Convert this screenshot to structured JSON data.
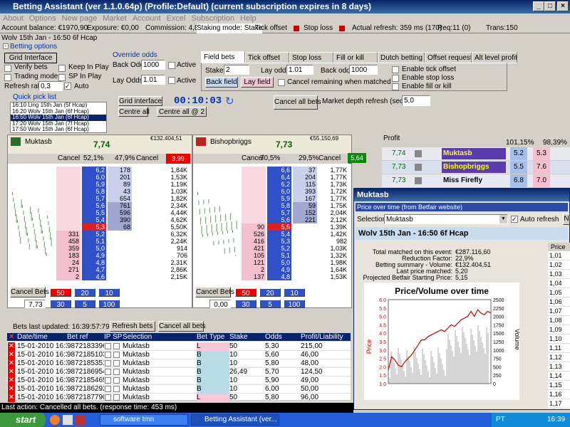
{
  "window": {
    "title": "Betting Assistant (ver 1.1.0.64p)     (Profile:Default)     (current subscription expires in 8 days)"
  },
  "menu": [
    "About",
    "Options",
    "New page",
    "Market",
    "Account",
    "Excel",
    "Subscription",
    "Help"
  ],
  "status": {
    "balance": "Account balance: €1970,90",
    "exposure": "Exposure: €0,00",
    "commission": "Commission: 4,80%",
    "staking": "Staking mode: Stake",
    "tick_offset": "Tick offset",
    "stop_loss": "Stop loss",
    "actual_refresh": "Actual refresh: 359 ms (170)",
    "req": "Req:11 (0)",
    "trans": "Trans:150"
  },
  "market_title": "Wolv 15th Jan - 16:50 6f Hcap",
  "betting_options": {
    "label": "Betting options",
    "grid_interface": "Grid Interface",
    "verify_bets": "Verify bets",
    "keep_in_play": "Keep In Play",
    "trading_mode": "Trading mode",
    "sp_in_play": "SP In Play",
    "refresh_rate": "Refresh rate",
    "refresh_value": "0,3",
    "auto": "Auto"
  },
  "override_odds": {
    "label": "Override odds",
    "back_odds": "Back Odds",
    "back_value": "1000",
    "lay_odds": "Lay Odds",
    "lay_value": "1.01",
    "active": "Active"
  },
  "tabs": [
    "Field bets",
    "Tick offset",
    "Stop loss",
    "Fill or kill",
    "Dutch betting",
    "Offset requests",
    "Alt level profit"
  ],
  "field_bets": {
    "stake": "Stake",
    "stake_value": "2",
    "lay_odds": "Lay odds",
    "lay_value": "1.01",
    "back_odds": "Back odds",
    "back_value": "1000",
    "back_field": "Back field",
    "lay_field": "Lay field",
    "cancel_remaining": "Cancel remaining when matched",
    "enable_tick": "Enable tick offset",
    "enable_stop": "Enable stop loss",
    "enable_fill": "Enable fill or kill"
  },
  "quick_pick": {
    "label": "Quick pick list",
    "items": [
      "16:10 Ling 15th Jan (5f Hcap)",
      "16:20 Wolv 15th Jan (6f Hcap)",
      "16:50 Wolv 15th Jan (6f Hcap)",
      "17:20 Wolv 15th Jan (7f Hcap)",
      "17:50 Wolv 15th Jan (6f Hcap)"
    ]
  },
  "controls": {
    "grid_interface": "Grid interface",
    "timer": "00:10:03",
    "centre_all": "Centre all",
    "centre_all_2": "Centre all @ 2",
    "cancel_all": "Cancel all bets",
    "depth_label": "Market depth refresh (seconds)",
    "depth_value": "5,0"
  },
  "ladder1": {
    "name": "Muktasb",
    "price": "7,74",
    "matched": "€132.404,51",
    "cancel": "Cancel",
    "back_pct": "52,1%",
    "lay_pct": "47,9%",
    "cancel2": "Cancel",
    "ltp": "3,99",
    "rows": [
      [
        "",
        "6,2",
        "178",
        "1,84K"
      ],
      [
        "",
        "6,0",
        "201",
        "1,53K"
      ],
      [
        "",
        "5,9",
        "89",
        "1,19K"
      ],
      [
        "",
        "5,8",
        "43",
        "1,03K"
      ],
      [
        "",
        "5,7",
        "654",
        "1,82K"
      ],
      [
        "",
        "5,6",
        "761",
        "2,34K"
      ],
      [
        "",
        "5,5",
        "596",
        "4,44K"
      ],
      [
        "",
        "5,4",
        "390",
        "4,62K"
      ],
      [
        "",
        "5,3",
        "68",
        "5,50K"
      ],
      [
        "331",
        "5,2",
        "",
        "6,32K"
      ],
      [
        "458",
        "5,1",
        "",
        "2,24K"
      ],
      [
        "359",
        "5,0",
        "",
        "914"
      ],
      [
        "183",
        "4,9",
        "",
        "706"
      ],
      [
        "24",
        "4,8",
        "",
        "2,31K"
      ],
      [
        "271",
        "4,7",
        "",
        "2,86K"
      ],
      [
        "2",
        "4,6",
        "",
        "2,15K"
      ]
    ],
    "cancel_bets": "Cancel Bets",
    "stake_display": "7,73",
    "b1": "50",
    "b2": "20",
    "b3": "10",
    "b4": "30",
    "b5": "5",
    "b6": "100"
  },
  "ladder2": {
    "name": "Bishopbriggs",
    "price": "7,73",
    "matched": "€55.150,69",
    "cancel": "Cancel",
    "back_pct": "70,5%",
    "lay_pct": "29,5%",
    "cancel2": "Cancel",
    "ltp": "5,64",
    "rows": [
      [
        "",
        "6,6",
        "37",
        "1,77K"
      ],
      [
        "",
        "6,4",
        "204",
        "1,77K"
      ],
      [
        "",
        "6,2",
        "115",
        "1,73K"
      ],
      [
        "",
        "6,0",
        "393",
        "1,72K"
      ],
      [
        "",
        "5,9",
        "167",
        "1,77K"
      ],
      [
        "",
        "5,8",
        "59",
        "1,75K"
      ],
      [
        "",
        "5,7",
        "152",
        "2,04K"
      ],
      [
        "",
        "5,6",
        "221",
        "2,12K"
      ],
      [
        "90",
        "5,5",
        "",
        "1,39K"
      ],
      [
        "526",
        "5,4",
        "",
        "1,42K"
      ],
      [
        "416",
        "5,3",
        "",
        "982"
      ],
      [
        "421",
        "5,2",
        "",
        "1,03K"
      ],
      [
        "105",
        "5,1",
        "",
        "1,32K"
      ],
      [
        "121",
        "5,0",
        "",
        "1,98K"
      ],
      [
        "2",
        "4,9",
        "",
        "1,64K"
      ],
      [
        "137",
        "4,8",
        "",
        "1,53K"
      ]
    ],
    "cancel_bets": "Cancel Bets",
    "stake_display": "0,00",
    "b1": "50",
    "b2": "20",
    "b3": "10",
    "b4": "30",
    "b5": "5",
    "b6": "100"
  },
  "profit": {
    "label": "Profit",
    "pct1": "101,15%",
    "pct2": "98,39%",
    "rows": [
      [
        "7,74",
        "Muktasb",
        "5.2",
        "5.3"
      ],
      [
        "7,73",
        "Bishopbriggs",
        "5.5",
        "7.6"
      ],
      [
        "7,73",
        "Miss Firefly",
        "6.8",
        "7.0"
      ]
    ]
  },
  "bets": {
    "last_updated": "Bets last updated: 16:39:57:796",
    "refresh": "Refresh bets",
    "cancel_all": "Cancel all bets",
    "headers": [
      "Date/time",
      "Bet ref",
      "IP",
      "SP",
      "Selection",
      "Bet Type",
      "Stake",
      "Odds",
      "Profit/Liability"
    ],
    "rows": [
      [
        "15-01-2010 16:34",
        "9872183396",
        "Muktasb",
        "L",
        "50",
        "5,30",
        "215,00"
      ],
      [
        "15-01-2010 16:34",
        "9872185103",
        "Muktasb",
        "B",
        "10",
        "5,60",
        "46,00"
      ],
      [
        "15-01-2010 16:34",
        "9872185351",
        "Muktasb",
        "B",
        "10",
        "5,80",
        "48,00"
      ],
      [
        "15-01-2010 16:34",
        "9872186954",
        "Muktasb",
        "B",
        "26,49",
        "5,70",
        "124,50"
      ],
      [
        "15-01-2010 16:34",
        "9872185465",
        "Muktasb",
        "B",
        "10",
        "5,90",
        "49,00"
      ],
      [
        "15-01-2010 16:34",
        "9872186292",
        "Muktasb",
        "B",
        "10",
        "6,00",
        "50,00"
      ],
      [
        "15-01-2010 16:34",
        "9872187790",
        "Muktasb",
        "L",
        "50",
        "5,80",
        "96,00"
      ]
    ]
  },
  "last_action": "Last action: Cancelled all bets. (response time: 453 ms)",
  "popup": {
    "title": "Muktasb",
    "subtitle": "Price over time (from Betfair website)",
    "selection_label": "Selection",
    "selection_value": "Muktasb",
    "auto_refresh": "Auto refresh",
    "market": "Wolv 15th Jan - 16:50 6f Hcap",
    "stats": [
      [
        "Total matched on this event:",
        "€287.116,60"
      ],
      [
        "Reduction Factor:",
        "22,9%"
      ],
      [
        "Betting summary - Volume:",
        "€132.404,51"
      ],
      [
        "Last price matched:",
        "5,20"
      ],
      [
        "Projected Betfair Starting Price:",
        "5,15"
      ]
    ],
    "price_header": "Price",
    "price_col": [
      "1,01",
      "1,02",
      "1,03",
      "1,04",
      "1,05",
      "1,06",
      "1,07",
      "1,08",
      "1,09",
      "1,10",
      "1,11",
      "1,12",
      "1,13",
      "1,14",
      "1,15",
      "1,16",
      "1,17"
    ]
  },
  "chart_data": {
    "type": "line",
    "title": "Price/Volume over time",
    "ylabel": "Price",
    "y2label": "Volume",
    "ylim": [
      1.0,
      6.0
    ],
    "y2lim": [
      0,
      2500
    ],
    "yticks": [
      "6.0",
      "5.5",
      "5.0",
      "4.5",
      "4.0",
      "3.5",
      "3.0",
      "2.5",
      "2.0",
      "1.5",
      "1.0"
    ],
    "y2ticks": [
      "2500",
      "2250",
      "2000",
      "1750",
      "1500",
      "1250",
      "1000",
      "750",
      "500",
      "250",
      "0"
    ],
    "series": [
      {
        "values": [
          1.8,
          2.6,
          2.4,
          2.1,
          2.0,
          2.3,
          2.5,
          2.7,
          3.0,
          3.3,
          3.6,
          3.6,
          3.8,
          3.9,
          4.0,
          4.1,
          4.2,
          4.1,
          4.3,
          4.5,
          4.4,
          4.6,
          4.8,
          4.9,
          5.0,
          5.3,
          5.0,
          5.4,
          5.2,
          5.1,
          5.3,
          5.2
        ]
      }
    ]
  },
  "taskbar": {
    "start": "start",
    "task1": "software tmn",
    "task2": "Betting Assistant (ver...",
    "lang": "PT",
    "clock": "16:39"
  }
}
